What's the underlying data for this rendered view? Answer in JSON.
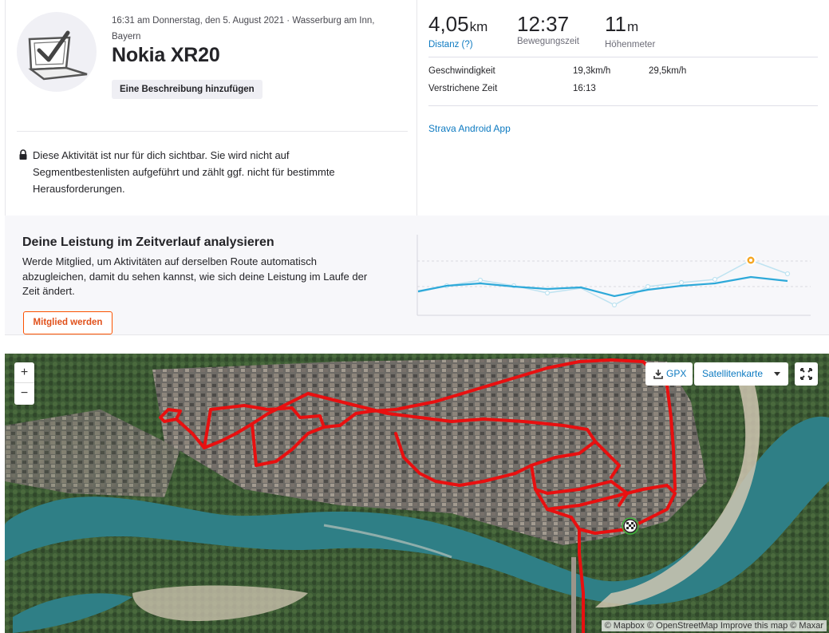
{
  "activity": {
    "meta_line1": "16:31 am Donnerstag, den 5. August 2021 · Wasserburg am Inn,",
    "meta_line2": "Bayern",
    "title": "Nokia XR20",
    "add_description": "Eine Beschreibung hinzufügen",
    "privacy_line1": "Diese Aktivität ist nur für dich sichtbar. Sie wird nicht auf",
    "privacy_line2": "Segmentbestenlisten aufgeführt und zählt ggf. nicht für bestimmte",
    "privacy_line3": "Herausforderungen."
  },
  "stats": {
    "distance_value": "4,05",
    "distance_unit": "km",
    "distance_label": "Distanz (?)",
    "moving_time_value": "12:37",
    "moving_time_label": "Bewegungszeit",
    "elevation_value": "11",
    "elevation_unit": "m",
    "elevation_label": "Höhenmeter",
    "speed_label": "Geschwindigkeit",
    "speed_avg": "19,3km/h",
    "speed_max": "29,5km/h",
    "elapsed_label": "Verstrichene Zeit",
    "elapsed_value": "16:13",
    "device": "Strava Android App"
  },
  "performance": {
    "heading": "Deine Leistung im Zeitverlauf analysieren",
    "text_line1": "Werde Mitglied, um Aktivitäten auf derselben Route automatisch",
    "text_line2": "abzugleichen, damit du sehen kannst, wie sich deine Leistung im Laufe der",
    "text_line3": "Zeit ändert.",
    "member_button": "Mitglied werden",
    "colors": {
      "line": "#2ea9d9",
      "faded_line": "#bfe3f1",
      "highlight": "#f5a623"
    }
  },
  "map": {
    "zoom_in": "+",
    "zoom_out": "−",
    "gpx_label": "GPX",
    "map_type": "Satellitenkarte",
    "attribution": "© Mapbox © OpenStreetMap Improve this map © Maxar",
    "route_color": "#e81010",
    "river_color": "#2f7f86"
  }
}
